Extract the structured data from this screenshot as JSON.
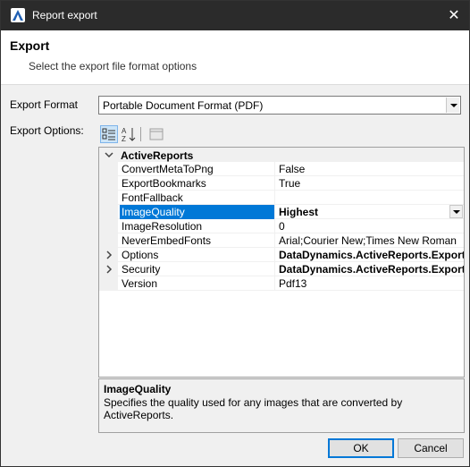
{
  "window": {
    "title": "Report export",
    "close_glyph": "✕"
  },
  "header": {
    "title": "Export",
    "subtitle": "Select the export file format options"
  },
  "form": {
    "export_format_label": "Export Format",
    "export_format_value": "Portable Document Format (PDF)",
    "export_options_label": "Export Options:"
  },
  "grid": {
    "category": "ActiveReports",
    "rows": [
      {
        "name": "ConvertMetaToPng",
        "value": "False"
      },
      {
        "name": "ExportBookmarks",
        "value": "True"
      },
      {
        "name": "FontFallback",
        "value": ""
      },
      {
        "name": "ImageQuality",
        "value": "Highest"
      },
      {
        "name": "ImageResolution",
        "value": "0"
      },
      {
        "name": "NeverEmbedFonts",
        "value": "Arial;Courier New;Times New Roman"
      },
      {
        "name": "Options",
        "value": "DataDynamics.ActiveReports.Export."
      },
      {
        "name": "Security",
        "value": "DataDynamics.ActiveReports.Export."
      },
      {
        "name": "Version",
        "value": "Pdf13"
      }
    ]
  },
  "description": {
    "title": "ImageQuality",
    "text": "Specifies the quality used for any images that are converted by ActiveReports."
  },
  "buttons": {
    "ok": "OK",
    "cancel": "Cancel"
  },
  "colors": {
    "titlebar": "#2b2b2b",
    "selection": "#0078d7"
  }
}
